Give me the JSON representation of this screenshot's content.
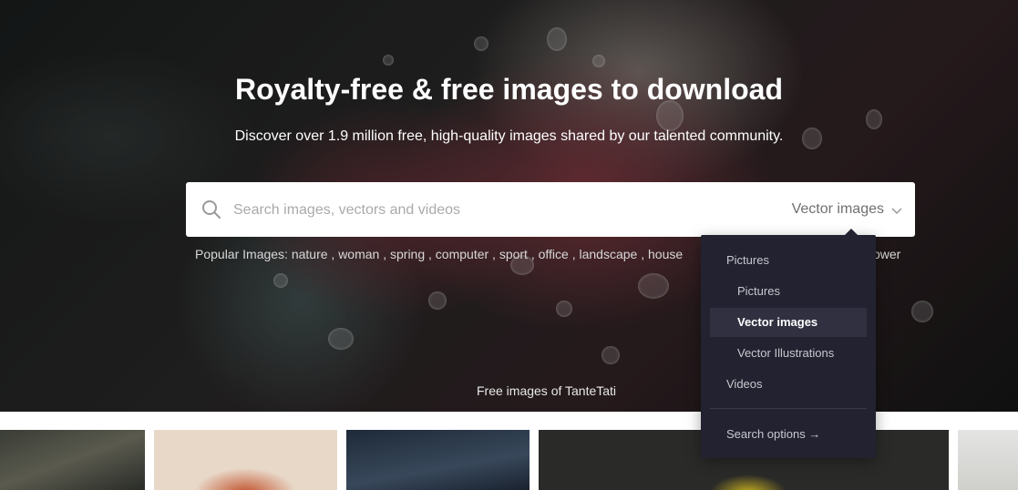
{
  "hero": {
    "title": "Royalty-free & free images to download",
    "subtitle": "Discover over 1.9 million free, high-quality images shared by our talented community.",
    "credit": "Free images of TanteTati"
  },
  "search": {
    "placeholder": "Search images, vectors and videos",
    "selected_type": "Vector images",
    "icon": "search-icon"
  },
  "popular": {
    "text": "Popular Images: nature , woman , spring , computer , sport , office , landscape , house",
    "tail": "ower"
  },
  "dropdown": {
    "items": [
      {
        "label": "Pictures"
      },
      {
        "label": "Pictures"
      },
      {
        "label": "Vector images"
      },
      {
        "label": "Vector Illustrations"
      },
      {
        "label": "Videos"
      }
    ],
    "search_options": "Search options →"
  },
  "colors": {
    "dropdown_bg": "#222230",
    "dropdown_active": "#303040"
  }
}
